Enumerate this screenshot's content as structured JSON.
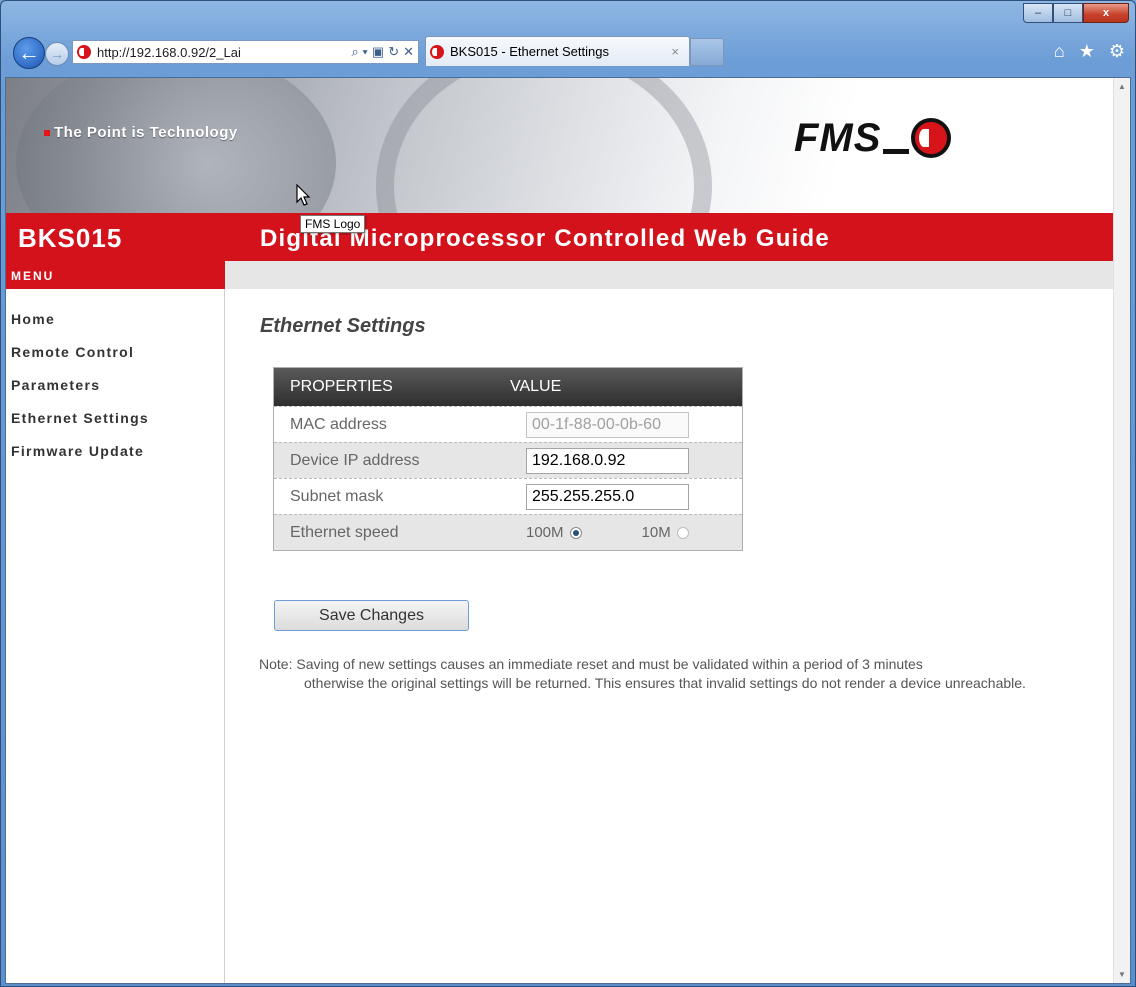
{
  "browser": {
    "address_url": "http://192.168.0.92/2_Lai",
    "tab_title": "BKS015 - Ethernet Settings",
    "tab_close": "×",
    "back_glyph": "←",
    "forward_glyph": "→",
    "address_tools": [
      "⌕ ▾",
      "▣",
      "↻",
      "✕"
    ],
    "right_tools": [
      "⌂",
      "★",
      "⚙"
    ],
    "window_controls": {
      "minimize": "–",
      "maximize": "□",
      "close": "x"
    }
  },
  "header": {
    "tagline": "The Point is Technology",
    "logo_text": "FMS",
    "model": "BKS015",
    "subtitle": "Digital Microprocessor Controlled Web Guide",
    "tooltip": "FMS Logo"
  },
  "menu": {
    "heading": "MENU",
    "items": [
      "Home",
      "Remote Control",
      "Parameters",
      "Ethernet Settings",
      "Firmware Update"
    ]
  },
  "main": {
    "title": "Ethernet Settings",
    "table": {
      "col_properties": "PROPERTIES",
      "col_value": "VALUE",
      "mac_label": "MAC address",
      "mac_value": "00-1f-88-00-0b-60",
      "ip_label": "Device IP address",
      "ip_value": "192.168.0.92",
      "subnet_label": "Subnet mask",
      "subnet_value": "255.255.255.0",
      "speed_label": "Ethernet speed",
      "speed_options": [
        "100M",
        "10M"
      ],
      "speed_selected": "100M"
    },
    "save_button": "Save Changes",
    "note_prefix": "Note:",
    "note_line1": "Saving of new settings causes an immediate reset and must be validated within a period of 3 minutes",
    "note_rest": "otherwise the original settings will be returned. This ensures that invalid settings do not render a device unreachable."
  },
  "colors": {
    "brand_red": "#d3121c",
    "header_dark": "#2e2e2e",
    "button_border": "#6e9ed6"
  },
  "icons": [
    "back-icon",
    "forward-icon",
    "search-icon",
    "compatibility-icon",
    "refresh-icon",
    "stop-icon",
    "home-icon",
    "favorites-star-icon",
    "gear-icon"
  ]
}
